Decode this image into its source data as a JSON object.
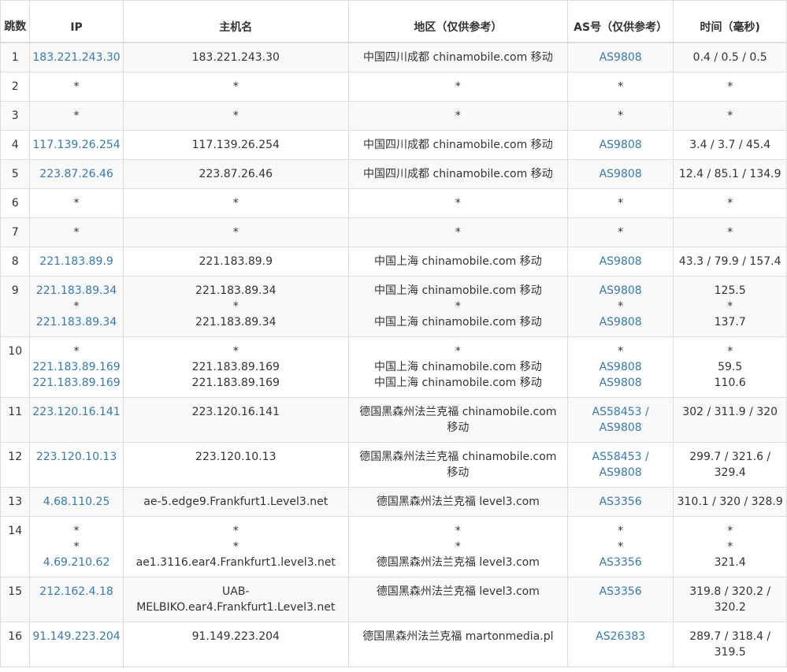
{
  "headers": {
    "hop": "跳数",
    "ip": "IP",
    "hostname": "主机名",
    "geo": "地区（仅供参考）",
    "as": "AS号（仅供参考）",
    "time": "时间（毫秒)"
  },
  "rows": [
    {
      "hop": "1",
      "ip": [
        "183.221.243.30"
      ],
      "host": [
        "183.221.243.30"
      ],
      "geo": [
        "中国四川成都 chinamobile.com 移动"
      ],
      "as": [
        "AS9808"
      ],
      "time": [
        "0.4 / 0.5 / 0.5"
      ]
    },
    {
      "hop": "2",
      "ip": [
        "*"
      ],
      "host": [
        "*"
      ],
      "geo": [
        "*"
      ],
      "as": [
        "*"
      ],
      "time": [
        "*"
      ]
    },
    {
      "hop": "3",
      "ip": [
        "*"
      ],
      "host": [
        "*"
      ],
      "geo": [
        "*"
      ],
      "as": [
        "*"
      ],
      "time": [
        "*"
      ]
    },
    {
      "hop": "4",
      "ip": [
        "117.139.26.254"
      ],
      "host": [
        "117.139.26.254"
      ],
      "geo": [
        "中国四川成都 chinamobile.com 移动"
      ],
      "as": [
        "AS9808"
      ],
      "time": [
        "3.4 / 3.7 / 45.4"
      ]
    },
    {
      "hop": "5",
      "ip": [
        "223.87.26.46"
      ],
      "host": [
        "223.87.26.46"
      ],
      "geo": [
        "中国四川成都 chinamobile.com 移动"
      ],
      "as": [
        "AS9808"
      ],
      "time": [
        "12.4 / 85.1 / 134.9"
      ]
    },
    {
      "hop": "6",
      "ip": [
        "*"
      ],
      "host": [
        "*"
      ],
      "geo": [
        "*"
      ],
      "as": [
        "*"
      ],
      "time": [
        "*"
      ]
    },
    {
      "hop": "7",
      "ip": [
        "*"
      ],
      "host": [
        "*"
      ],
      "geo": [
        "*"
      ],
      "as": [
        "*"
      ],
      "time": [
        "*"
      ]
    },
    {
      "hop": "8",
      "ip": [
        "221.183.89.9"
      ],
      "host": [
        "221.183.89.9"
      ],
      "geo": [
        "中国上海 chinamobile.com 移动"
      ],
      "as": [
        "AS9808"
      ],
      "time": [
        "43.3 / 79.9 / 157.4"
      ]
    },
    {
      "hop": "9",
      "ip": [
        "221.183.89.34",
        "*",
        "221.183.89.34"
      ],
      "host": [
        "221.183.89.34",
        "*",
        "221.183.89.34"
      ],
      "geo": [
        "中国上海 chinamobile.com 移动",
        "*",
        "中国上海 chinamobile.com 移动"
      ],
      "as": [
        "AS9808",
        "*",
        "AS9808"
      ],
      "time": [
        "125.5",
        "*",
        "137.7"
      ]
    },
    {
      "hop": "10",
      "ip": [
        "*",
        "221.183.89.169",
        "221.183.89.169"
      ],
      "host": [
        "*",
        "221.183.89.169",
        "221.183.89.169"
      ],
      "geo": [
        "*",
        "中国上海 chinamobile.com 移动",
        "中国上海 chinamobile.com 移动"
      ],
      "as": [
        "*",
        "AS9808",
        "AS9808"
      ],
      "time": [
        "*",
        "59.5",
        "110.6"
      ]
    },
    {
      "hop": "11",
      "ip": [
        "223.120.16.141"
      ],
      "host": [
        "223.120.16.141"
      ],
      "geo": [
        "德国黑森州法兰克福 chinamobile.com",
        "移动"
      ],
      "as": [
        "AS58453 /",
        "AS9808"
      ],
      "time": [
        "302 / 311.9 / 320"
      ]
    },
    {
      "hop": "12",
      "ip": [
        "223.120.10.13"
      ],
      "host": [
        "223.120.10.13"
      ],
      "geo": [
        "德国黑森州法兰克福 chinamobile.com",
        "移动"
      ],
      "as": [
        "AS58453 /",
        "AS9808"
      ],
      "time": [
        "299.7 / 321.6 /",
        "329.4"
      ]
    },
    {
      "hop": "13",
      "ip": [
        "4.68.110.25"
      ],
      "host": [
        "ae-5.edge9.Frankfurt1.Level3.net"
      ],
      "geo": [
        "德国黑森州法兰克福 level3.com"
      ],
      "as": [
        "AS3356"
      ],
      "time": [
        "310.1 / 320 / 328.9"
      ]
    },
    {
      "hop": "14",
      "ip": [
        "*",
        "*",
        "4.69.210.62"
      ],
      "host": [
        "*",
        "*",
        "ae1.3116.ear4.Frankfurt1.level3.net"
      ],
      "geo": [
        "*",
        "*",
        "德国黑森州法兰克福 level3.com"
      ],
      "as": [
        "*",
        "*",
        "AS3356"
      ],
      "time": [
        "*",
        "*",
        "321.4"
      ]
    },
    {
      "hop": "15",
      "ip": [
        "212.162.4.18"
      ],
      "host": [
        "UAB-",
        "MELBIKO.ear4.Frankfurt1.Level3.net"
      ],
      "geo": [
        "德国黑森州法兰克福 level3.com"
      ],
      "as": [
        "AS3356"
      ],
      "time": [
        "319.8 / 320.2 /",
        "320.2"
      ]
    },
    {
      "hop": "16",
      "ip": [
        "91.149.223.204"
      ],
      "host": [
        "91.149.223.204"
      ],
      "geo": [
        "德国黑森州法兰克福 martonmedia.pl"
      ],
      "as": [
        "AS26383"
      ],
      "time": [
        "289.7 / 318.4 /",
        "319.5"
      ]
    }
  ]
}
